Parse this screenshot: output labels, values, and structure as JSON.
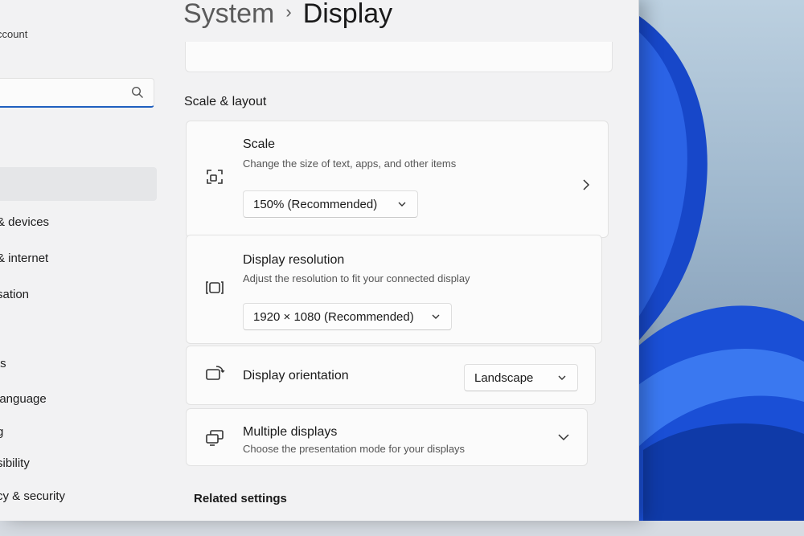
{
  "nav": {
    "account_text": "ccount",
    "search_placeholder": "",
    "items": [
      "& devices",
      "& internet",
      "sation",
      "ts",
      "language",
      "g",
      "sibility",
      "cy & security"
    ]
  },
  "breadcrumb": {
    "parent": "System",
    "separator": "›",
    "current": "Display"
  },
  "section_title": "Scale & layout",
  "cards": {
    "scale": {
      "title": "Scale",
      "desc": "Change the size of text, apps, and other items",
      "value": "150% (Recommended)",
      "icon": "scale-icon"
    },
    "resolution": {
      "title": "Display resolution",
      "desc": "Adjust the resolution to fit your connected display",
      "value": "1920 × 1080 (Recommended)",
      "icon": "resolution-icon"
    },
    "orientation": {
      "title": "Display orientation",
      "value": "Landscape",
      "icon": "orientation-icon"
    },
    "multiple": {
      "title": "Multiple displays",
      "desc": "Choose the presentation mode for your displays",
      "icon": "multiple-displays-icon"
    }
  },
  "related_title": "Related settings",
  "colors": {
    "accent": "#1f5fbf",
    "wallpaper_blue": "#1a4fd6"
  }
}
